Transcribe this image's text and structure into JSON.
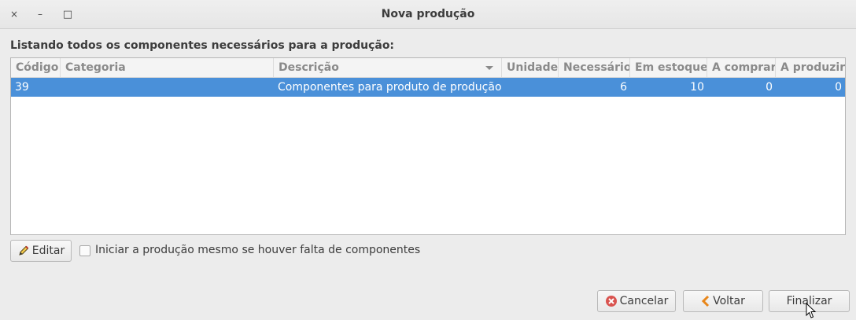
{
  "window": {
    "title": "Nova produção",
    "close_glyph": "×",
    "minimize_glyph": "–",
    "maximize_glyph": "□"
  },
  "heading": "Listando todos os componentes necessários para a produção:",
  "table": {
    "columns": [
      "Código",
      "Categoria",
      "Descrição",
      "Unidade",
      "Necessário",
      "Em estoque",
      "A comprar",
      "A produzir"
    ],
    "sorted_column": "Descrição",
    "rows": [
      {
        "codigo": "39",
        "categoria": "",
        "descricao": "Componentes para produto de produção",
        "unidade": "",
        "necessario": "6",
        "em_estoque": "10",
        "a_comprar": "0",
        "a_produzir": "0",
        "selected": true
      }
    ]
  },
  "edit_button": {
    "label": "Editar",
    "icon": "pencil-icon"
  },
  "checkbox": {
    "label": "Iniciar a produção mesmo se houver falta de componentes",
    "checked": false
  },
  "footer": {
    "cancel": {
      "label": "Cancelar",
      "icon": "cancel-icon"
    },
    "back": {
      "label": "Voltar",
      "icon": "chevron-left-icon"
    },
    "finish": {
      "label": "Finalizar"
    }
  },
  "colors": {
    "selection": "#4a90d9",
    "cancel_icon": "#d9534f",
    "back_icon": "#e8861a"
  }
}
